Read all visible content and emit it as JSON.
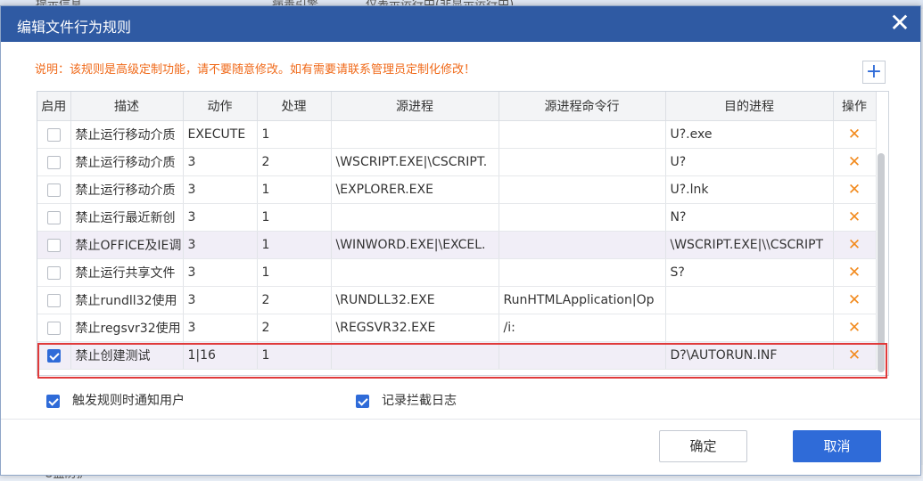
{
  "background": {
    "text_left": "提示信息",
    "text_mid": "病毒引擎",
    "text_right": "仅表示运行中(非显示运行中)",
    "bottom_text": "U盘防护"
  },
  "dialog": {
    "title": "编辑文件行为规则",
    "notice": "说明：该规则是高级定制功能，请不要随意修改。如有需要请联系管理员定制化修改！",
    "add_symbol": "+",
    "close_symbol": "✕"
  },
  "table": {
    "headers": [
      "启用",
      "描述",
      "动作",
      "处理",
      "源进程",
      "源进程命令行",
      "目的进程",
      "操作"
    ],
    "delete_symbol": "✕",
    "rows": [
      {
        "enabled": false,
        "desc": "禁止运行移动介质",
        "action": "EXECUTE",
        "handle": "1",
        "src": "",
        "cmd": "",
        "dst": "U?.exe"
      },
      {
        "enabled": false,
        "desc": "禁止运行移动介质",
        "action": "3",
        "handle": "2",
        "src": "\\WSCRIPT.EXE|\\CSCRIPT.",
        "cmd": "",
        "dst": "U?"
      },
      {
        "enabled": false,
        "desc": "禁止运行移动介质",
        "action": "3",
        "handle": "1",
        "src": "\\EXPLORER.EXE",
        "cmd": "",
        "dst": "U?.lnk"
      },
      {
        "enabled": false,
        "desc": "禁止运行最近新创",
        "action": "3",
        "handle": "1",
        "src": "",
        "cmd": "",
        "dst": "N?"
      },
      {
        "enabled": false,
        "desc": "禁止OFFICE及IE调",
        "action": "3",
        "handle": "1",
        "src": "\\WINWORD.EXE|\\EXCEL.",
        "cmd": "",
        "dst": "\\WSCRIPT.EXE|\\\\CSCRIPT"
      },
      {
        "enabled": false,
        "desc": "禁止运行共享文件",
        "action": "3",
        "handle": "1",
        "src": "",
        "cmd": "",
        "dst": "S?"
      },
      {
        "enabled": false,
        "desc": "禁止rundll32使用",
        "action": "3",
        "handle": "2",
        "src": "\\RUNDLL32.EXE",
        "cmd": "RunHTMLApplication|Op",
        "dst": ""
      },
      {
        "enabled": false,
        "desc": "禁止regsvr32使用",
        "action": "3",
        "handle": "2",
        "src": "\\REGSVR32.EXE",
        "cmd": "/i:",
        "dst": ""
      },
      {
        "enabled": true,
        "desc": "禁止创建测试",
        "action": "1|16",
        "handle": "1",
        "src": "",
        "cmd": "",
        "dst": "D?\\AUTORUN.INF"
      }
    ]
  },
  "options": {
    "notify_label": "触发规则时通知用户",
    "notify_checked": true,
    "log_label": "记录拦截日志",
    "log_checked": true
  },
  "buttons": {
    "ok": "确定",
    "cancel": "取消"
  },
  "colors": {
    "titlebar": "#2f5aa3",
    "accent": "#2f6bd8",
    "notice": "#f06a1a",
    "delete": "#f28a1d",
    "highlight_border": "#e03a3a"
  }
}
